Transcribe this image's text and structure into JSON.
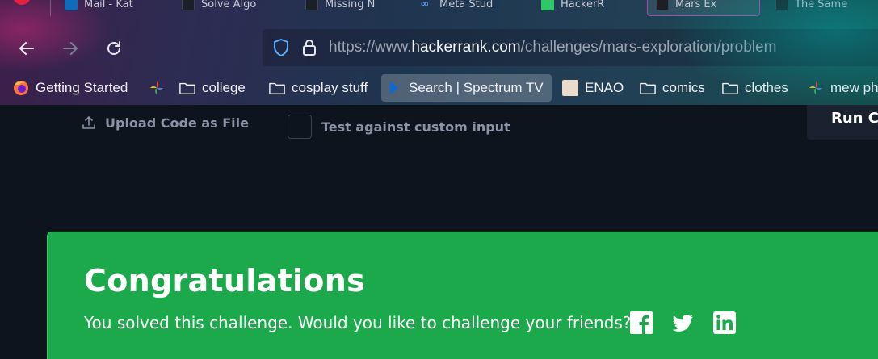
{
  "browser": {
    "tabs": [
      {
        "label": "Mail - Kat"
      },
      {
        "label": "Solve Algo"
      },
      {
        "label": "Missing N"
      },
      {
        "label": "Meta Stud"
      },
      {
        "label": "HackerR"
      },
      {
        "label": "Mars Ex"
      },
      {
        "label": "The Same"
      }
    ],
    "url": {
      "prefix": "https://www.",
      "domain": "hackerrank.com",
      "path": "/challenges/mars-exploration/problem"
    },
    "bookmarks": [
      {
        "label": "Getting Started",
        "icon": "firefox-icon"
      },
      {
        "label": "college",
        "icon": "folder-icon"
      },
      {
        "label": "cosplay stuff",
        "icon": "folder-icon"
      },
      {
        "label": "Search | Spectrum TV",
        "icon": "spectrum-icon"
      },
      {
        "label": "ENAO",
        "icon": "enao-icon"
      },
      {
        "label": "comics",
        "icon": "folder-icon"
      },
      {
        "label": "clothes",
        "icon": "folder-icon"
      },
      {
        "label": "mew ph",
        "icon": "google-photos-icon"
      }
    ]
  },
  "editor_toolbar": {
    "upload_label": "Upload Code as File",
    "custom_input_label": "Test against custom input",
    "run_label": "Run C"
  },
  "success_banner": {
    "title": "Congratulations",
    "message": "You solved this challenge. Would you like to challenge your friends?",
    "share_icons": [
      "facebook-icon",
      "twitter-icon",
      "linkedin-icon"
    ]
  },
  "colors": {
    "page_bg": "#0e141e",
    "success_green": "#1ba94c",
    "muted_text": "#8a94a6"
  }
}
